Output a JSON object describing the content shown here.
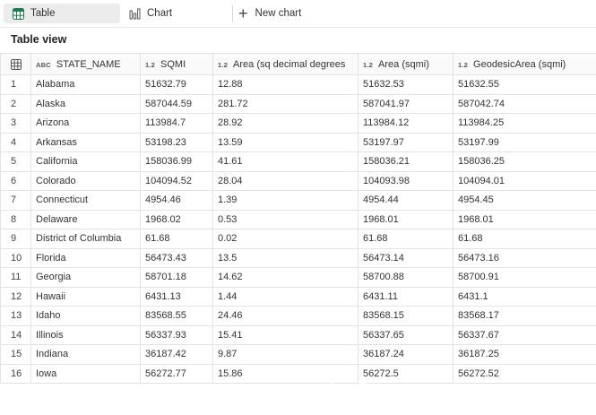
{
  "toolbar": {
    "tab_table": "Table",
    "tab_chart": "Chart",
    "new_chart": "New chart"
  },
  "view_title": "Table view",
  "table": {
    "columns": [
      {
        "type": "",
        "label": ""
      },
      {
        "type": "ABC",
        "label": "STATE_NAME"
      },
      {
        "type": "1.2",
        "label": "SQMI"
      },
      {
        "type": "1.2",
        "label": "Area (sq decimal degrees"
      },
      {
        "type": "1.2",
        "label": "Area (sqmi)"
      },
      {
        "type": "1.2",
        "label": "GeodesicArea (sqmi)"
      }
    ],
    "rows": [
      [
        "1",
        "Alabama",
        "51632.79",
        "12.88",
        "51632.53",
        "51632.55"
      ],
      [
        "2",
        "Alaska",
        "587044.59",
        "281.72",
        "587041.97",
        "587042.74"
      ],
      [
        "3",
        "Arizona",
        "113984.7",
        "28.92",
        "113984.12",
        "113984.25"
      ],
      [
        "4",
        "Arkansas",
        "53198.23",
        "13.59",
        "53197.97",
        "53197.99"
      ],
      [
        "5",
        "California",
        "158036.99",
        "41.61",
        "158036.21",
        "158036.25"
      ],
      [
        "6",
        "Colorado",
        "104094.52",
        "28.04",
        "104093.98",
        "104094.01"
      ],
      [
        "7",
        "Connecticut",
        "4954.46",
        "1.39",
        "4954.44",
        "4954.45"
      ],
      [
        "8",
        "Delaware",
        "1968.02",
        "0.53",
        "1968.01",
        "1968.01"
      ],
      [
        "9",
        "District of Columbia",
        "61.68",
        "0.02",
        "61.68",
        "61.68"
      ],
      [
        "10",
        "Florida",
        "56473.43",
        "13.5",
        "56473.14",
        "56473.16"
      ],
      [
        "11",
        "Georgia",
        "58701.18",
        "14.62",
        "58700.88",
        "58700.91"
      ],
      [
        "12",
        "Hawaii",
        "6431.13",
        "1.44",
        "6431.11",
        "6431.1"
      ],
      [
        "13",
        "Idaho",
        "83568.55",
        "24.46",
        "83568.15",
        "83568.17"
      ],
      [
        "14",
        "Illinois",
        "56337.93",
        "15.41",
        "56337.65",
        "56337.67"
      ],
      [
        "15",
        "Indiana",
        "36187.42",
        "9.87",
        "36187.24",
        "36187.25"
      ],
      [
        "16",
        "Iowa",
        "56272.77",
        "15.86",
        "56272.5",
        "56272.52"
      ]
    ]
  }
}
